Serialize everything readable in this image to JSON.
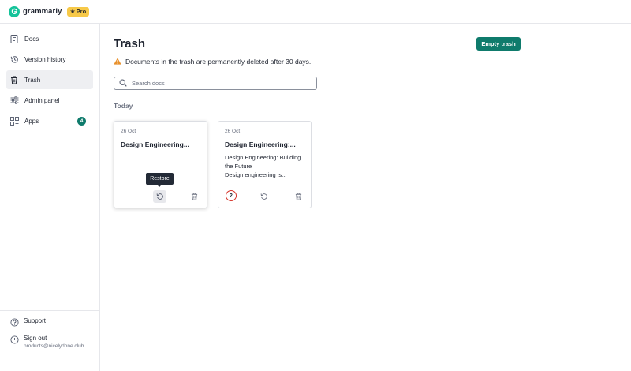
{
  "app": {
    "logo_text": "grammarly",
    "pro_label": "Pro",
    "icons": {
      "logo": "grammarly-g-icon",
      "star": "star-icon"
    },
    "colors": {
      "brand_green": "#15c39a",
      "accent": "#0f7b6c",
      "pro_yellow": "#f7c948",
      "warning": "#e8912d",
      "count_ring": "#d5352b"
    }
  },
  "sidebar": {
    "items": [
      {
        "label": "Docs",
        "icon": "document-icon",
        "active": false
      },
      {
        "label": "Version history",
        "icon": "history-icon",
        "active": false
      },
      {
        "label": "Trash",
        "icon": "trash-icon",
        "active": true
      },
      {
        "label": "Admin panel",
        "icon": "sliders-icon",
        "active": false
      },
      {
        "label": "Apps",
        "icon": "apps-grid-icon",
        "active": false,
        "badge": "4"
      }
    ],
    "support_label": "Support",
    "sign_out_label": "Sign out",
    "user_email": "products@nicelydone.club"
  },
  "main": {
    "title": "Trash",
    "empty_button": "Empty trash",
    "warning_text": "Documents in the trash are permanently deleted after 30 days.",
    "search_placeholder": "Search docs",
    "section_label": "Today",
    "tooltip": "Restore",
    "cards": [
      {
        "date": "26 Oct",
        "title": "Design Engineering...",
        "body_lines": []
      },
      {
        "date": "26 Oct",
        "title": "Design Engineering:...",
        "body_lines": [
          "Design Engineering: Building",
          "the Future",
          "Design engineering is..."
        ],
        "count": "2"
      }
    ]
  }
}
